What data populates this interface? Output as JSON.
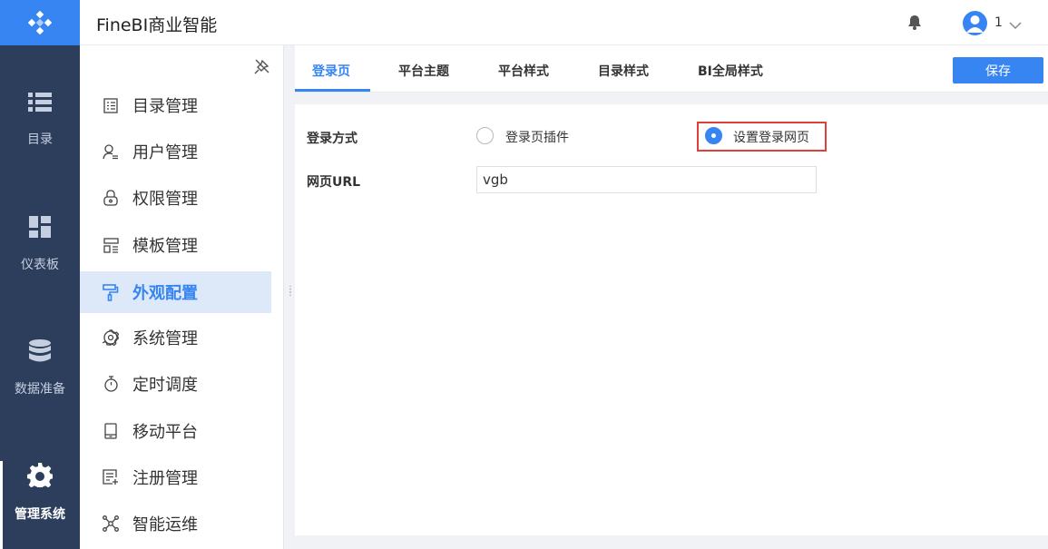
{
  "app": {
    "title": "FineBI商业智能"
  },
  "rail": {
    "items": [
      {
        "label": "目录",
        "icon": "list-icon"
      },
      {
        "label": "仪表板",
        "icon": "dashboard-icon"
      },
      {
        "label": "数据准备",
        "icon": "database-icon"
      },
      {
        "label": "管理系统",
        "icon": "gear-icon",
        "active": true
      }
    ]
  },
  "header": {
    "user_name": "1"
  },
  "sidebar": {
    "items": [
      {
        "label": "目录管理",
        "icon": "catalog-icon"
      },
      {
        "label": "用户管理",
        "icon": "user-icon"
      },
      {
        "label": "权限管理",
        "icon": "lock-icon"
      },
      {
        "label": "模板管理",
        "icon": "template-icon"
      },
      {
        "label": "外观配置",
        "icon": "paint-roller-icon",
        "active": true
      },
      {
        "label": "系统管理",
        "icon": "cog-icon"
      },
      {
        "label": "定时调度",
        "icon": "timer-icon"
      },
      {
        "label": "移动平台",
        "icon": "mobile-icon"
      },
      {
        "label": "注册管理",
        "icon": "register-icon"
      },
      {
        "label": "智能运维",
        "icon": "network-icon"
      }
    ]
  },
  "tabs": [
    {
      "label": "登录页",
      "active": true
    },
    {
      "label": "平台主题"
    },
    {
      "label": "平台样式"
    },
    {
      "label": "目录样式"
    },
    {
      "label": "BI全局样式"
    }
  ],
  "toolbar": {
    "save_label": "保存"
  },
  "form": {
    "login_method": {
      "label": "登录方式",
      "options": [
        {
          "label": "登录页插件",
          "checked": false
        },
        {
          "label": "设置登录网页",
          "checked": true
        }
      ]
    },
    "url": {
      "label": "网页URL",
      "value": "vgb"
    }
  },
  "colors": {
    "accent": "#3685f2",
    "rail_bg": "#2c3e5c",
    "highlight": "#e0403a"
  }
}
